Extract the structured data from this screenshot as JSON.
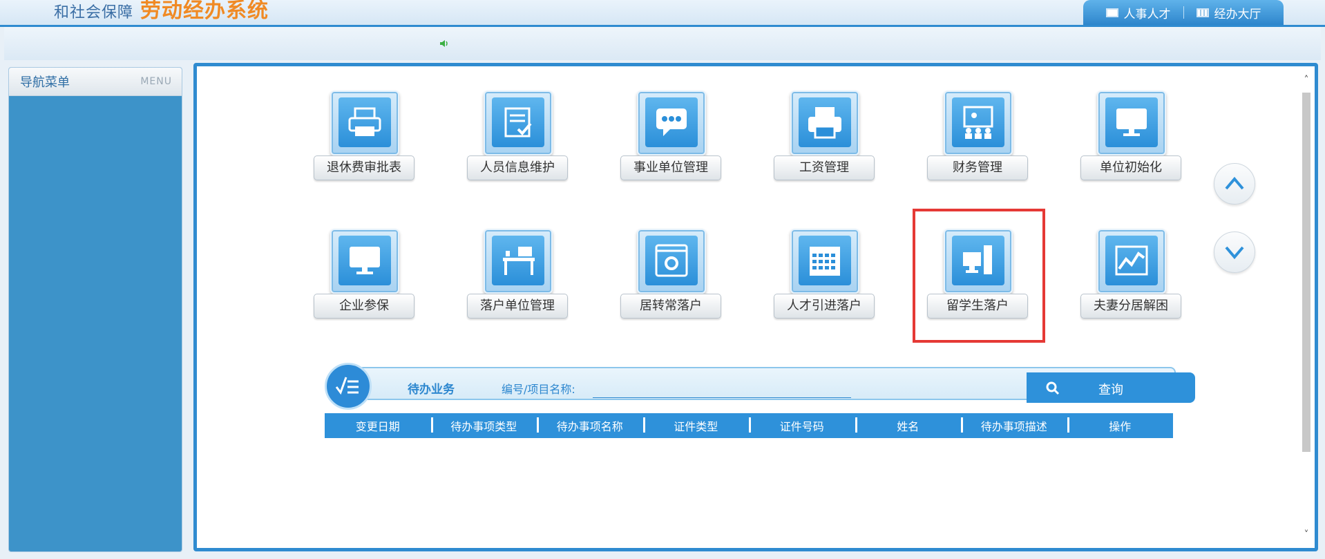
{
  "header": {
    "title_left": "和社会保障",
    "title_main": "劳动经办系统",
    "tabs": [
      {
        "label": "人事人才",
        "icon": "id-card-icon"
      },
      {
        "label": "经办大厅",
        "icon": "building-icon"
      }
    ]
  },
  "sidebar": {
    "title": "导航菜单",
    "menu_label": "MENU"
  },
  "tiles": [
    {
      "label": "退休费审批表",
      "icon": "printer-icon"
    },
    {
      "label": "人员信息维护",
      "icon": "document-check-icon"
    },
    {
      "label": "事业单位管理",
      "icon": "chat-bubble-icon"
    },
    {
      "label": "工资管理",
      "icon": "printer-icon"
    },
    {
      "label": "财务管理",
      "icon": "presentation-icon"
    },
    {
      "label": "单位初始化",
      "icon": "monitor-icon"
    },
    {
      "label": "企业参保",
      "icon": "monitor-icon"
    },
    {
      "label": "落户单位管理",
      "icon": "desk-icon"
    },
    {
      "label": "居转常落户",
      "icon": "gear-window-icon"
    },
    {
      "label": "人才引进落户",
      "icon": "calendar-icon"
    },
    {
      "label": "留学生落户",
      "icon": "computer-tower-icon"
    },
    {
      "label": "夫妻分居解困",
      "icon": "chart-icon"
    }
  ],
  "pending": {
    "title": "待办业务",
    "search_label": "编号/项目名称:",
    "search_value": "",
    "query_label": "查询",
    "columns": [
      "变更日期",
      "待办事项类型",
      "待办事项名称",
      "证件类型",
      "证件号码",
      "姓名",
      "待办事项描述",
      "操作"
    ]
  },
  "colors": {
    "primary": "#2e91da",
    "highlight": "#e53935",
    "accent": "#f08a24"
  }
}
